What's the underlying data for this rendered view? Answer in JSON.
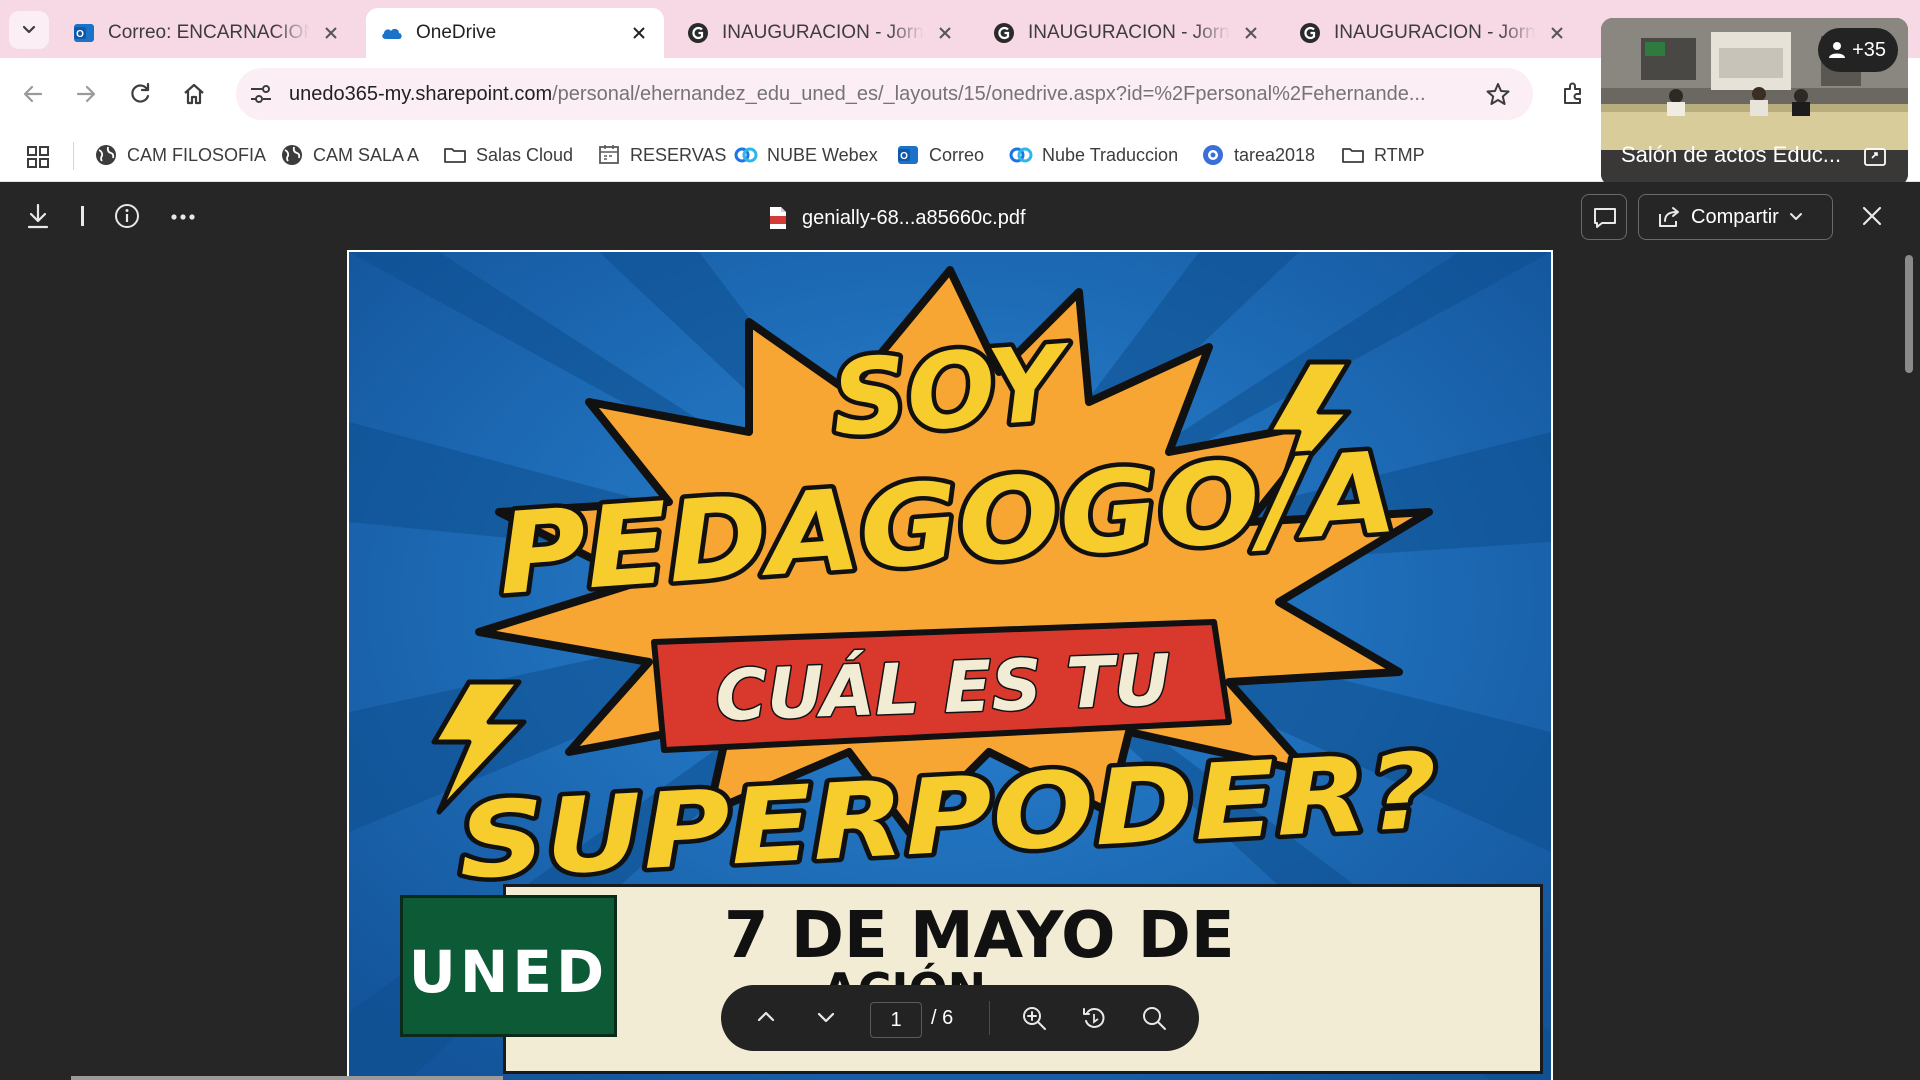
{
  "browser": {
    "tabs": [
      {
        "title": "Correo: ENCARNACION HERNANDEZ",
        "favicon": "outlook-icon",
        "active": false
      },
      {
        "title": "OneDrive",
        "favicon": "onedrive-icon",
        "active": true
      },
      {
        "title": "INAUGURACION - Jornadas",
        "favicon": "genially-icon",
        "active": false
      },
      {
        "title": "INAUGURACION - Jornadas",
        "favicon": "genially-icon",
        "active": false
      },
      {
        "title": "INAUGURACION - Jornadas",
        "favicon": "genially-icon",
        "active": false
      }
    ],
    "address": {
      "host": "unedo365-my.sharepoint.com",
      "path": "/personal/ehernandez_edu_uned_es/_layouts/15/onedrive.aspx?id=%2Fpersonal%2Fehernande..."
    },
    "bookmarks": [
      {
        "label": "CAM FILOSOFIA",
        "icon": "globe-icon"
      },
      {
        "label": "CAM SALA A",
        "icon": "globe-icon"
      },
      {
        "label": "Salas Cloud",
        "icon": "folder-icon"
      },
      {
        "label": "RESERVAS",
        "icon": "calendar-icon"
      },
      {
        "label": "NUBE Webex",
        "icon": "webex-icon"
      },
      {
        "label": "Correo",
        "icon": "outlook-icon"
      },
      {
        "label": "Nube Traduccion",
        "icon": "webex-icon"
      },
      {
        "label": "tarea2018",
        "icon": "blue-circle-icon"
      },
      {
        "label": "RTMP",
        "icon": "folder-icon"
      }
    ]
  },
  "video_overlay": {
    "participants_badge": "+35",
    "caption": "Salón de actos Educ..."
  },
  "viewer": {
    "filename": "genially-68...a85660c.pdf",
    "share_label": "Compartir",
    "current_page": "1",
    "total_pages": "/ 6"
  },
  "document": {
    "headline_line1": "SOY",
    "headline_line2": "PEDAGOGO/A",
    "banner": "CUÁL ES TU",
    "headline_line3": "SUPERPODER?",
    "logo_text": "UNED",
    "date_line1": "7 DE MAYO DE",
    "date_line2_visible": "ACIÓN"
  },
  "colors": {
    "tab_strip": "#f7d9e6",
    "poster_blue": "#1a66b4",
    "burst_orange": "#f7a533",
    "headline_yellow": "#f7cd2e",
    "banner_red": "#d9382c",
    "uned_green": "#0d5a36"
  }
}
